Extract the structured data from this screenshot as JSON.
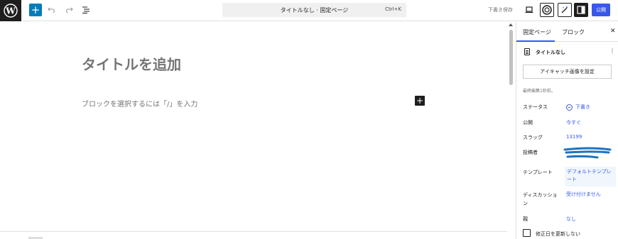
{
  "toolbar": {
    "logo_icon": "wordpress-icon",
    "add_icon": "plus-icon",
    "undo_icon": "undo-icon",
    "redo_icon": "redo-icon",
    "outline_icon": "list-view-icon",
    "command_title": "タイトルなし · 固定ページ",
    "command_shortcut": "Ctrl+K",
    "save_draft": "下書き保存",
    "preview_icon": "desktop-icon",
    "jetpack_icon": "jetpack-icon",
    "ai_icon": "ai-wand-icon",
    "settings_icon": "sidebar-icon",
    "publish_label": "公開",
    "publish_color": "#3858e9"
  },
  "editor": {
    "title_placeholder": "タイトルを追加",
    "block_placeholder": "ブロックを選択するには「/」を入力",
    "inserter_icon": "plus-icon"
  },
  "sidebar": {
    "tabs": [
      "固定ページ",
      "ブロック"
    ],
    "close_icon": "close-icon",
    "page_icon": "page-icon",
    "page_name": "タイトルなし",
    "page_menu_icon": "more-vertical-icon",
    "featured_image_button": "アイキャッチ画像を設定",
    "last_edited": "最終編集1秒前。",
    "properties": {
      "status_label": "ステータス",
      "status_value": "下書き",
      "publish_label": "公開",
      "publish_value": "今すぐ",
      "slug_label": "スラッグ",
      "slug_value": "13199",
      "author_label": "投稿者",
      "template_label": "テンプレート",
      "template_value": "デフォルトテンプレート",
      "discussion_label": "ディスカッション",
      "discussion_value": "受け付けません",
      "parent_label": "親",
      "parent_value": "なし"
    },
    "checkbox_label": "修正日を更新しない"
  }
}
